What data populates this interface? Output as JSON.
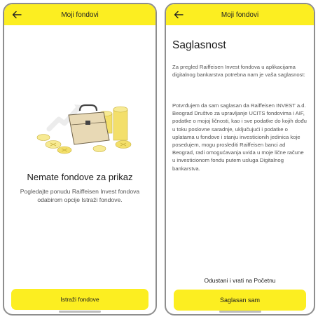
{
  "screens": [
    {
      "header": {
        "title": "Moji fondovi",
        "back_icon": "arrow-left-icon"
      },
      "illustration": {
        "name": "briefcase-coins-growth"
      },
      "empty_state": {
        "title": "Nemate fondove za prikaz",
        "description": "Pogledajte ponudu Raiffeisen Invest fondova odabirom opcije Istraži fondove."
      },
      "primary_button": {
        "label": "Istraži fondove"
      }
    },
    {
      "header": {
        "title": "Moji fondovi",
        "back_icon": "arrow-left-icon"
      },
      "consent": {
        "title": "Saglasnost",
        "intro": "Za pregled Raiffeisen Invest fondova u aplikacijama digitalnog bankarstva potrebna nam je vaša saglasnost:",
        "body": "Potvrđujem da sam saglasan da Raiffeisen INVEST a.d. Beograd Društvo za upravljanje UCITS fondovima i AIF, podatke o mojoj ličnosti, kao i sve podatke do kojih dođu u toku poslovne saradnje, uključujući i podatke o uplatama u fondove i stanju investicionih jedinica koje posedujem, mogu proslediti Raiffeisen banci ad Beograd, radi omogućavanja uvida u moje lične račune u investicionom fondu putem usluga Digitalnog bankarstva."
      },
      "cancel_link": {
        "label": "Odustani i vrati na Početnu"
      },
      "primary_button": {
        "label": "Saglasan sam"
      }
    }
  ],
  "colors": {
    "accent": "#fcee21",
    "text": "#1a1a1a",
    "muted": "#555555"
  }
}
